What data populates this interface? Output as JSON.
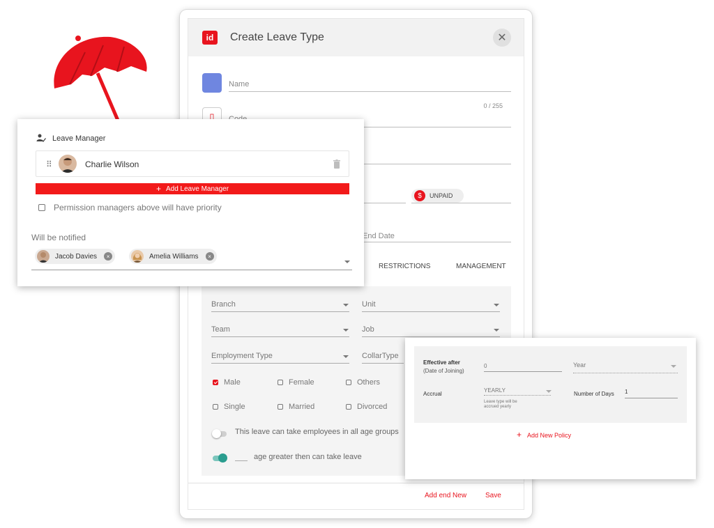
{
  "modal": {
    "logo": "id",
    "title": "Create Leave Type",
    "close_icon": "✕",
    "name_label": "Name",
    "counter": "0 / 255",
    "code_label": "Code",
    "unpaid_icon": "$",
    "unpaid_label": "UNPAID",
    "end_date_label": "End Date",
    "tabs": [
      "RESTRICTIONS",
      "MANAGEMENT"
    ],
    "filters": {
      "branch": "Branch",
      "unit": "Unit",
      "team": "Team",
      "job": "Job",
      "employment_type": "Employment Type",
      "collar_type": "CollarType"
    },
    "genders": [
      "Male",
      "Female",
      "Others"
    ],
    "marital": [
      "Single",
      "Married",
      "Divorced"
    ],
    "toggle_all_ages": "This leave can take employees in all age groups",
    "toggle_age_greater": "age greater then can take leave",
    "footer": {
      "add_and_new": "Add end New",
      "save": "Save"
    },
    "colors": {
      "accent": "#e8141e",
      "swatch": "#6f86e0",
      "toggle_on": "#2a9d8f"
    }
  },
  "leave_manager": {
    "title": "Leave Manager",
    "managers": [
      {
        "name": "Charlie Wilson"
      }
    ],
    "add_button": "Add Leave Manager",
    "add_icon": "+",
    "permission_text": "Permission managers above will have priority",
    "notified_label": "Will be notified",
    "notified": [
      {
        "name": "Jacob Davies"
      },
      {
        "name": "Amelia Williams"
      }
    ],
    "chip_remove_icon": "×"
  },
  "policy": {
    "effective_label": "Effective after",
    "effective_sub": "(Date of Joining)",
    "effective_value": "0",
    "period": "Year",
    "accrual_label": "Accrual",
    "accrual_value": "YEARLY",
    "accrual_hint_1": "Leave type will be",
    "accrual_hint_2": "accrued yearly",
    "days_label": "Number of Days",
    "days_value": "1",
    "add_policy": "Add New Policy",
    "add_icon": "+"
  }
}
